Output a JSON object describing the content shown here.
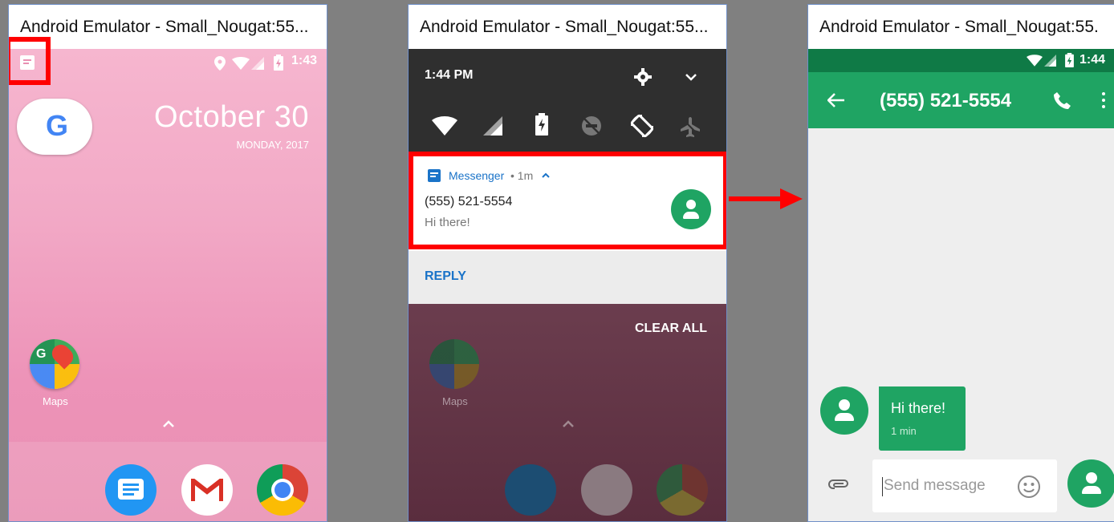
{
  "windows": [
    {
      "title": "Android Emulator - Small_Nougat:55...",
      "status_time": "1:43",
      "date": "October 30",
      "day": "MONDAY, 2017",
      "app_label": "Maps"
    },
    {
      "title": "Android Emulator - Small_Nougat:55...",
      "shade_time": "1:44 PM",
      "notification": {
        "app": "Messenger",
        "meta": "• 1m",
        "sender": "(555) 521-5554",
        "message": "Hi there!",
        "reply": "REPLY",
        "clear_all": "CLEAR ALL"
      },
      "app_label": "Maps"
    },
    {
      "title": "Android Emulator - Small_Nougat:55.",
      "status_time": "1:44",
      "conversation_title": "(555) 521-5554",
      "bubble_text": "Hi there!",
      "bubble_time": "1 min",
      "compose_placeholder": "Send message"
    }
  ],
  "colors": {
    "accent_red": "#ff0000",
    "messenger_green": "#1fa463",
    "messenger_dark_green": "#0f7a46",
    "link_blue": "#1a73c8"
  }
}
